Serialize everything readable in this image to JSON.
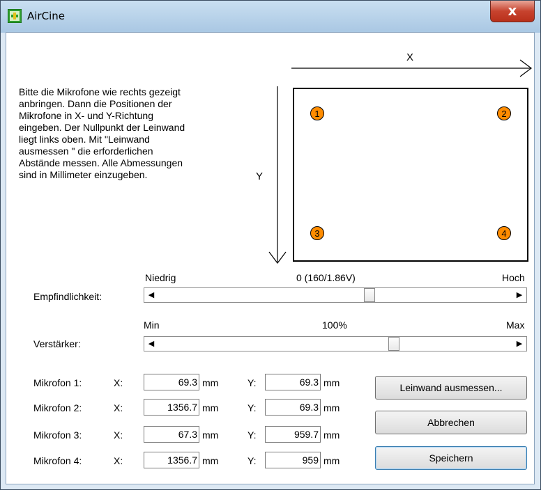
{
  "window": {
    "title": "AirCine",
    "close_symbol": "x"
  },
  "instructions": "Bitte die Mikrofone wie rechts gezeigt\nanbringen. Dann die Positionen der\nMikrofone in X- und Y-Richtung\neingeben. Der Nullpunkt der Leinwand\nliegt links oben. Mit \"Leinwand\nausmessen \" die erforderlichen\nAbstände messen. Alle Abmessungen\nsind in Millimeter einzugeben.",
  "diagram": {
    "x_label": "X",
    "y_label": "Y",
    "mic_markers": [
      "1",
      "2",
      "3",
      "4"
    ],
    "marker_color": "#ff8c00"
  },
  "sensitivity": {
    "label": "Empfindlichkeit:",
    "min_label": "Niedrig",
    "max_label": "Hoch",
    "value_label": "0 (160/1.86V)",
    "position": 0.6
  },
  "gain": {
    "label": "Verstärker:",
    "min_label": "Min",
    "max_label": "Max",
    "value_label": "100%",
    "position": 0.67
  },
  "mics": [
    {
      "label": "Mikrofon 1:",
      "x_prefix": "X:",
      "x": "69.3",
      "y_prefix": "Y:",
      "y": "69.3",
      "unit": "mm"
    },
    {
      "label": "Mikrofon 2:",
      "x_prefix": "X:",
      "x": "1356.7",
      "y_prefix": "Y:",
      "y": "69.3",
      "unit": "mm"
    },
    {
      "label": "Mikrofon 3:",
      "x_prefix": "X:",
      "x": "67.3",
      "y_prefix": "Y:",
      "y": "959.7",
      "unit": "mm"
    },
    {
      "label": "Mikrofon 4:",
      "x_prefix": "X:",
      "x": "1356.7",
      "y_prefix": "Y:",
      "y": "959",
      "unit": "mm"
    }
  ],
  "buttons": {
    "measure": "Leinwand ausmessen...",
    "cancel": "Abbrechen",
    "save": "Speichern"
  }
}
